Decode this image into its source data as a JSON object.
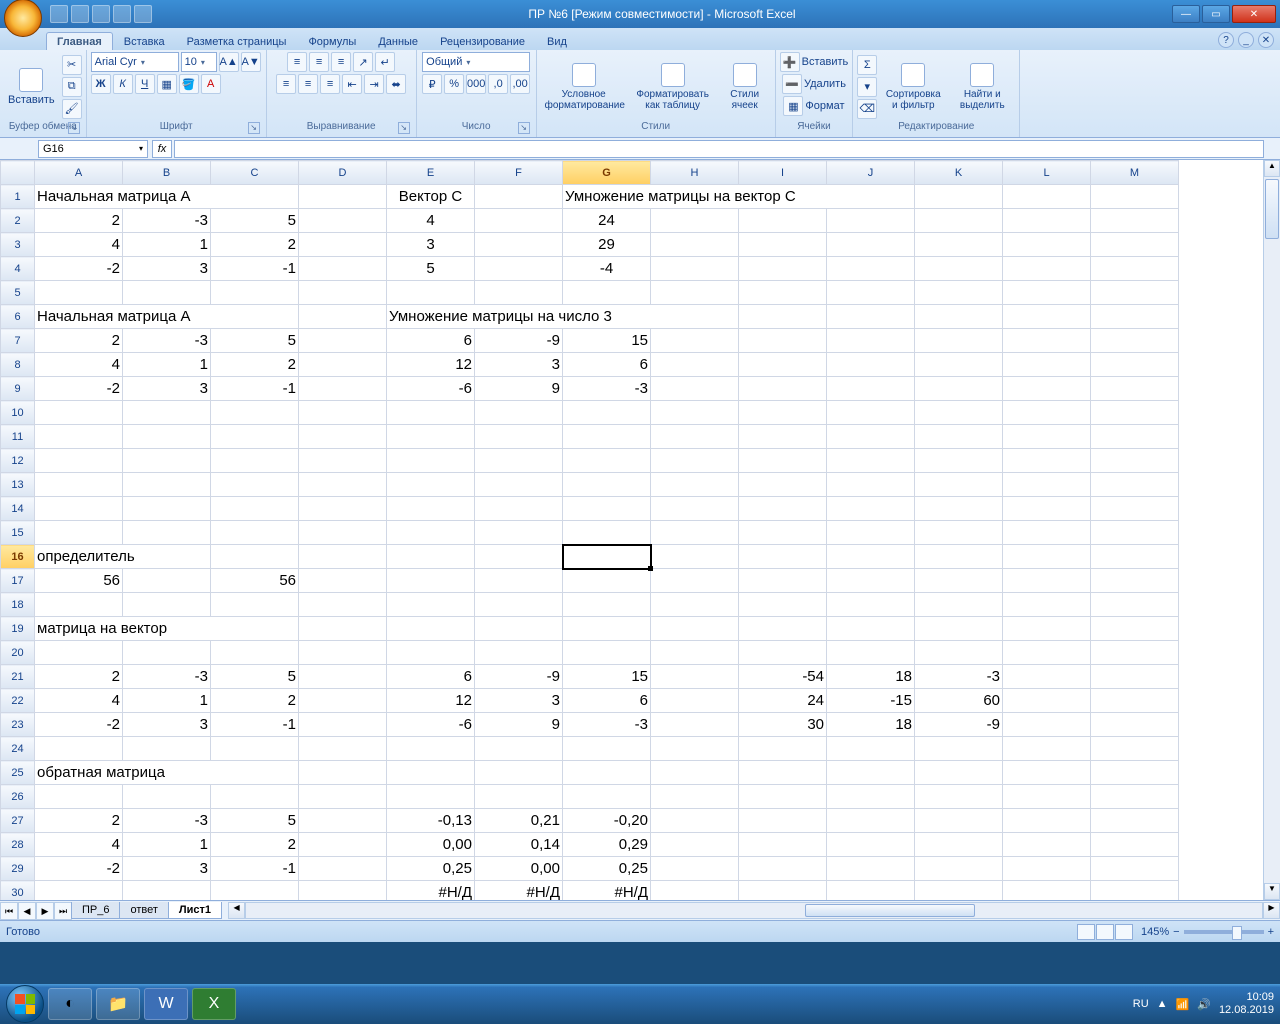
{
  "window": {
    "title": "ПР №6  [Режим совместимости] - Microsoft Excel"
  },
  "tabs": [
    "Главная",
    "Вставка",
    "Разметка страницы",
    "Формулы",
    "Данные",
    "Рецензирование",
    "Вид"
  ],
  "active_tab": 0,
  "ribbon": {
    "clipboard": {
      "paste": "Вставить",
      "label": "Буфер обмена"
    },
    "font": {
      "name": "Arial Cyr",
      "size": "10",
      "label": "Шрифт"
    },
    "align": {
      "label": "Выравнивание"
    },
    "number": {
      "format": "Общий",
      "label": "Число"
    },
    "styles": {
      "cond": "Условное форматирование",
      "table": "Форматировать как таблицу",
      "cell": "Стили ячеек",
      "label": "Стили"
    },
    "cells": {
      "insert": "Вставить",
      "delete": "Удалить",
      "format": "Формат",
      "label": "Ячейки"
    },
    "editing": {
      "sort": "Сортировка и фильтр",
      "find": "Найти и выделить",
      "label": "Редактирование"
    }
  },
  "namebox": "G16",
  "formula": "",
  "columns": [
    "A",
    "B",
    "C",
    "D",
    "E",
    "F",
    "G",
    "H",
    "I",
    "J",
    "K",
    "L",
    "M"
  ],
  "selected_col_idx": 6,
  "selected_row": 16,
  "selected_cell": "G16",
  "rows": [
    {
      "n": 1,
      "cells": {
        "A": {
          "v": "Начальная матрица А",
          "t": "txt",
          "span": 3
        },
        "E": {
          "v": "Вектор С",
          "t": "ctr"
        },
        "G": {
          "v": "Умножение матрицы на вектор С",
          "t": "txt",
          "span": 4
        }
      }
    },
    {
      "n": 2,
      "cells": {
        "A": {
          "v": "2",
          "t": "num"
        },
        "B": {
          "v": "-3",
          "t": "num"
        },
        "C": {
          "v": "5",
          "t": "num"
        },
        "E": {
          "v": "4",
          "t": "ctr"
        },
        "G": {
          "v": "24",
          "t": "ctr"
        }
      }
    },
    {
      "n": 3,
      "cells": {
        "A": {
          "v": "4",
          "t": "num"
        },
        "B": {
          "v": "1",
          "t": "num"
        },
        "C": {
          "v": "2",
          "t": "num"
        },
        "E": {
          "v": "3",
          "t": "ctr"
        },
        "G": {
          "v": "29",
          "t": "ctr"
        }
      }
    },
    {
      "n": 4,
      "cells": {
        "A": {
          "v": "-2",
          "t": "num"
        },
        "B": {
          "v": "3",
          "t": "num"
        },
        "C": {
          "v": "-1",
          "t": "num"
        },
        "E": {
          "v": "5",
          "t": "ctr"
        },
        "G": {
          "v": "-4",
          "t": "ctr"
        }
      }
    },
    {
      "n": 5,
      "cells": {}
    },
    {
      "n": 6,
      "cells": {
        "A": {
          "v": "Начальная матрица А",
          "t": "txt",
          "span": 3
        },
        "E": {
          "v": "Умножение матрицы на число 3",
          "t": "txt",
          "span": 4
        }
      }
    },
    {
      "n": 7,
      "cells": {
        "A": {
          "v": "2",
          "t": "num"
        },
        "B": {
          "v": "-3",
          "t": "num"
        },
        "C": {
          "v": "5",
          "t": "num"
        },
        "E": {
          "v": "6",
          "t": "num"
        },
        "F": {
          "v": "-9",
          "t": "num"
        },
        "G": {
          "v": "15",
          "t": "num"
        }
      }
    },
    {
      "n": 8,
      "cells": {
        "A": {
          "v": "4",
          "t": "num"
        },
        "B": {
          "v": "1",
          "t": "num"
        },
        "C": {
          "v": "2",
          "t": "num"
        },
        "E": {
          "v": "12",
          "t": "num"
        },
        "F": {
          "v": "3",
          "t": "num"
        },
        "G": {
          "v": "6",
          "t": "num"
        }
      }
    },
    {
      "n": 9,
      "cells": {
        "A": {
          "v": "-2",
          "t": "num"
        },
        "B": {
          "v": "3",
          "t": "num"
        },
        "C": {
          "v": "-1",
          "t": "num"
        },
        "E": {
          "v": "-6",
          "t": "num"
        },
        "F": {
          "v": "9",
          "t": "num"
        },
        "G": {
          "v": "-3",
          "t": "num"
        }
      }
    },
    {
      "n": 10,
      "cells": {}
    },
    {
      "n": 11,
      "cells": {}
    },
    {
      "n": 12,
      "cells": {}
    },
    {
      "n": 13,
      "cells": {}
    },
    {
      "n": 14,
      "cells": {}
    },
    {
      "n": 15,
      "cells": {}
    },
    {
      "n": 16,
      "cells": {
        "A": {
          "v": "определитель",
          "t": "txt",
          "span": 2
        }
      }
    },
    {
      "n": 17,
      "cells": {
        "A": {
          "v": "56",
          "t": "num"
        },
        "C": {
          "v": "56",
          "t": "num"
        }
      }
    },
    {
      "n": 18,
      "cells": {}
    },
    {
      "n": 19,
      "cells": {
        "A": {
          "v": "матрица на вектор",
          "t": "txt",
          "span": 3
        }
      }
    },
    {
      "n": 20,
      "cells": {}
    },
    {
      "n": 21,
      "cells": {
        "A": {
          "v": "2",
          "t": "num"
        },
        "B": {
          "v": "-3",
          "t": "num"
        },
        "C": {
          "v": "5",
          "t": "num"
        },
        "E": {
          "v": "6",
          "t": "num"
        },
        "F": {
          "v": "-9",
          "t": "num"
        },
        "G": {
          "v": "15",
          "t": "num"
        },
        "I": {
          "v": "-54",
          "t": "num"
        },
        "J": {
          "v": "18",
          "t": "num"
        },
        "K": {
          "v": "-3",
          "t": "num"
        }
      }
    },
    {
      "n": 22,
      "cells": {
        "A": {
          "v": "4",
          "t": "num"
        },
        "B": {
          "v": "1",
          "t": "num"
        },
        "C": {
          "v": "2",
          "t": "num"
        },
        "E": {
          "v": "12",
          "t": "num"
        },
        "F": {
          "v": "3",
          "t": "num"
        },
        "G": {
          "v": "6",
          "t": "num"
        },
        "I": {
          "v": "24",
          "t": "num"
        },
        "J": {
          "v": "-15",
          "t": "num"
        },
        "K": {
          "v": "60",
          "t": "num"
        }
      }
    },
    {
      "n": 23,
      "cells": {
        "A": {
          "v": "-2",
          "t": "num"
        },
        "B": {
          "v": "3",
          "t": "num"
        },
        "C": {
          "v": "-1",
          "t": "num"
        },
        "E": {
          "v": "-6",
          "t": "num"
        },
        "F": {
          "v": "9",
          "t": "num"
        },
        "G": {
          "v": "-3",
          "t": "num"
        },
        "I": {
          "v": "30",
          "t": "num"
        },
        "J": {
          "v": "18",
          "t": "num"
        },
        "K": {
          "v": "-9",
          "t": "num"
        }
      }
    },
    {
      "n": 24,
      "cells": {}
    },
    {
      "n": 25,
      "cells": {
        "A": {
          "v": "обратная матрица",
          "t": "txt",
          "span": 3
        }
      }
    },
    {
      "n": 26,
      "cells": {}
    },
    {
      "n": 27,
      "cells": {
        "A": {
          "v": "2",
          "t": "num"
        },
        "B": {
          "v": "-3",
          "t": "num"
        },
        "C": {
          "v": "5",
          "t": "num"
        },
        "E": {
          "v": "-0,13",
          "t": "num"
        },
        "F": {
          "v": "0,21",
          "t": "num"
        },
        "G": {
          "v": "-0,20",
          "t": "num"
        }
      }
    },
    {
      "n": 28,
      "cells": {
        "A": {
          "v": "4",
          "t": "num"
        },
        "B": {
          "v": "1",
          "t": "num"
        },
        "C": {
          "v": "2",
          "t": "num"
        },
        "E": {
          "v": "0,00",
          "t": "num"
        },
        "F": {
          "v": "0,14",
          "t": "num"
        },
        "G": {
          "v": "0,29",
          "t": "num"
        }
      }
    },
    {
      "n": 29,
      "cells": {
        "A": {
          "v": "-2",
          "t": "num"
        },
        "B": {
          "v": "3",
          "t": "num"
        },
        "C": {
          "v": "-1",
          "t": "num"
        },
        "E": {
          "v": "0,25",
          "t": "num"
        },
        "F": {
          "v": "0,00",
          "t": "num"
        },
        "G": {
          "v": "0,25",
          "t": "num"
        }
      }
    },
    {
      "n": 30,
      "cells": {
        "E": {
          "v": "#Н/Д",
          "t": "num"
        },
        "F": {
          "v": "#Н/Д",
          "t": "num"
        },
        "G": {
          "v": "#Н/Д",
          "t": "num"
        }
      }
    }
  ],
  "sheets": [
    "ПР_6",
    "ответ",
    "Лист1"
  ],
  "active_sheet": 2,
  "status": {
    "ready": "Готово",
    "zoom": "145%"
  },
  "tray": {
    "lang": "RU",
    "time": "10:09",
    "date": "12.08.2019"
  }
}
